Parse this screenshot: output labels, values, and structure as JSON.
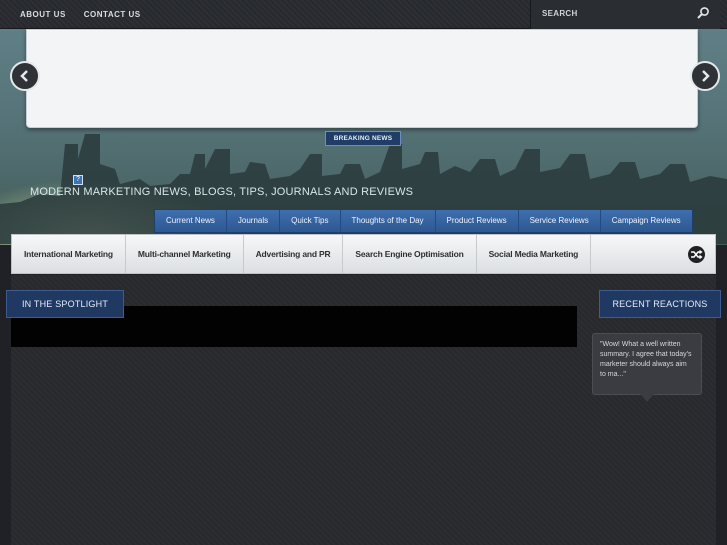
{
  "topbar": {
    "links": [
      "ABOUT US",
      "CONTACT US"
    ],
    "search_placeholder": "SEARCH",
    "search_icon": "search-icon"
  },
  "header": {
    "breaking_news": "BREAKING NEWS",
    "tagline": "MODERN MARKETING NEWS, BLOGS, TIPS, JOURNALS AND REVIEWS",
    "help_icon_text": "?",
    "slider_icons": [
      "chevron-left-icon",
      "chevron-right-icon"
    ]
  },
  "categories": [
    "Current News",
    "Journals",
    "Quick Tips",
    "Thoughts of the Day",
    "Product Reviews",
    "Service Reviews",
    "Campaign Reviews"
  ],
  "nav": {
    "items": [
      "International Marketing",
      "Multi-channel Marketing",
      "Advertising and PR",
      "Search Engine Optimisation",
      "Social Media Marketing"
    ],
    "shuffle_icon": "shuffle-icon"
  },
  "spotlight": {
    "label": "IN THE SPOTLIGHT"
  },
  "reactions": {
    "label": "RECENT REACTIONS",
    "comment": "\"Wow! What a well written summary. I agree that today's marketer should always aim to ma...\""
  },
  "colors": {
    "accent": "#2d5892",
    "label_bg": "#203963",
    "background": "#1f2126"
  }
}
